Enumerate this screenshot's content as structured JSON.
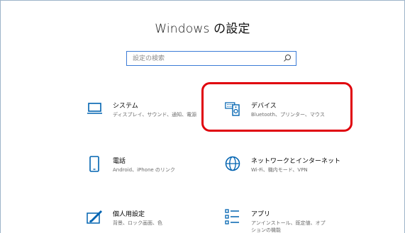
{
  "window": {
    "title": "Windows の設定"
  },
  "search": {
    "placeholder": "設定の検索",
    "value": ""
  },
  "tiles": [
    {
      "id": "system",
      "icon": "laptop-icon",
      "label": "システム",
      "desc": "ディスプレイ、サウンド、通知、電源"
    },
    {
      "id": "devices",
      "icon": "keyboard-speaker-icon",
      "label": "デバイス",
      "desc": "Bluetooth、プリンター、マウス"
    },
    {
      "id": "phone",
      "icon": "phone-icon",
      "label": "電話",
      "desc": "Android、iPhone のリンク"
    },
    {
      "id": "network",
      "icon": "globe-icon",
      "label": "ネットワークとインターネット",
      "desc": "Wi-Fi、機内モード、VPN"
    },
    {
      "id": "personalization",
      "icon": "paintbrush-icon",
      "label": "個人用設定",
      "desc": "背景、ロック画面、色"
    },
    {
      "id": "apps",
      "icon": "apps-list-icon",
      "label": "アプリ",
      "desc": "アンインストール、既定値、オプションの機能"
    }
  ],
  "colors": {
    "accent": "#0063b1",
    "highlight": "#e0000b",
    "search_border": "#3c7bd6"
  }
}
